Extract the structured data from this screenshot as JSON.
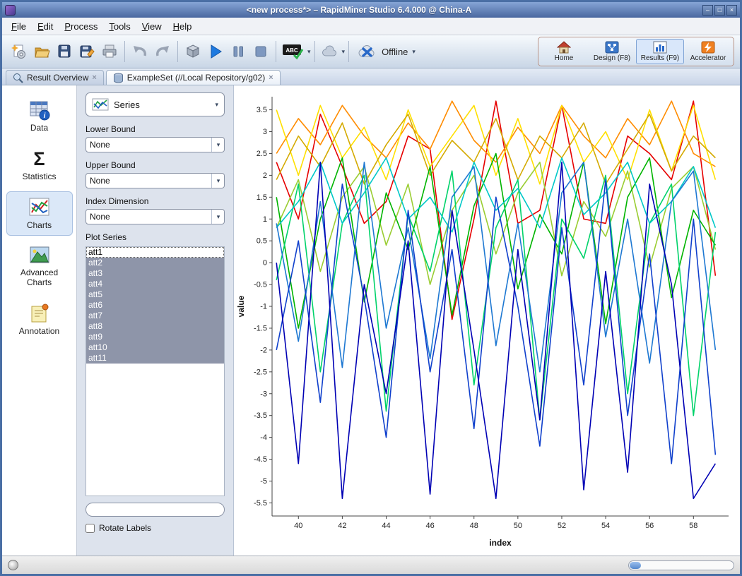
{
  "window": {
    "title": "<new process*> – RapidMiner Studio 6.4.000 @ China-A"
  },
  "icons": {
    "caret": "▾",
    "close": "×",
    "minimize": "–",
    "maximize": "□",
    "info": "i",
    "sigma": "Σ",
    "check": "✓"
  },
  "menu": {
    "items": [
      "File",
      "Edit",
      "Process",
      "Tools",
      "View",
      "Help"
    ]
  },
  "toolbar": {
    "abc_label": "ABC",
    "offline_label": "Offline"
  },
  "perspectives": {
    "items": [
      "Home",
      "Design (F8)",
      "Results (F9)",
      "Accelerator"
    ]
  },
  "tabs": [
    "Result Overview",
    "ExampleSet (//Local Repository/g02)"
  ],
  "sidebar": {
    "items": [
      "Data",
      "Statistics",
      "Charts",
      "Advanced Charts",
      "Annotation"
    ]
  },
  "config": {
    "chart_type": "Series",
    "lower_bound_label": "Lower Bound",
    "lower_bound_value": "None",
    "upper_bound_label": "Upper Bound",
    "upper_bound_value": "None",
    "index_dim_label": "Index Dimension",
    "index_dim_value": "None",
    "plot_series_label": "Plot Series",
    "series_items": [
      "att1",
      "att2",
      "att3",
      "att4",
      "att5",
      "att6",
      "att7",
      "att8",
      "att9",
      "att10",
      "att11"
    ],
    "filter_value": "",
    "rotate_labels_label": "Rotate Labels"
  },
  "chart_data": {
    "type": "line",
    "title": "",
    "xlabel": "index",
    "ylabel": "value",
    "xlim": [
      38.8,
      59.6
    ],
    "ylim": [
      -5.8,
      3.8
    ],
    "x_ticks": [
      40,
      42,
      44,
      46,
      48,
      50,
      52,
      54,
      56,
      58
    ],
    "y_ticks": [
      3.5,
      3,
      2.5,
      2,
      1.5,
      1,
      0.5,
      0,
      -0.5,
      -1,
      -1.5,
      -2,
      -2.5,
      -3,
      -3.5,
      -4,
      -4.5,
      -5,
      -5.5
    ],
    "grid": false,
    "legend": "none",
    "x": [
      39,
      40,
      41,
      42,
      43,
      44,
      45,
      46,
      47,
      48,
      49,
      50,
      51,
      52,
      53,
      54,
      55,
      56,
      57,
      58,
      59
    ],
    "series": [
      {
        "name": "att1",
        "color": "#e60000",
        "values": [
          2.3,
          1.0,
          3.4,
          2.2,
          0.9,
          1.4,
          2.9,
          2.6,
          -1.3,
          1.0,
          3.7,
          0.9,
          1.2,
          3.6,
          1.0,
          0.9,
          2.9,
          2.5,
          1.9,
          3.7,
          -0.3
        ]
      },
      {
        "name": "att2",
        "color": "#ff8c00",
        "values": [
          2.5,
          3.3,
          2.7,
          3.6,
          2.9,
          2.4,
          3.2,
          2.6,
          3.7,
          2.8,
          2.3,
          3.1,
          2.5,
          3.6,
          2.9,
          2.4,
          3.3,
          2.7,
          3.7,
          2.5,
          2.2
        ]
      },
      {
        "name": "att3",
        "color": "#ffe000",
        "values": [
          3.5,
          2.0,
          3.6,
          2.4,
          3.1,
          1.9,
          3.5,
          2.2,
          2.9,
          3.6,
          2.0,
          3.3,
          1.8,
          3.6,
          2.3,
          3.0,
          1.9,
          3.5,
          2.1,
          3.6,
          1.9
        ]
      },
      {
        "name": "att4",
        "color": "#d4aa00",
        "values": [
          1.9,
          2.9,
          2.2,
          3.2,
          1.8,
          2.7,
          3.4,
          2.0,
          2.8,
          2.3,
          3.3,
          1.9,
          2.9,
          2.4,
          3.2,
          1.8,
          2.6,
          3.4,
          2.1,
          2.9,
          2.4
        ]
      },
      {
        "name": "att5",
        "color": "#9acd32",
        "values": [
          0.8,
          1.9,
          -0.2,
          1.5,
          2.2,
          0.4,
          1.8,
          -0.5,
          1.2,
          2.0,
          0.2,
          1.6,
          2.3,
          -0.3,
          1.4,
          0.6,
          2.1,
          -0.1,
          1.7,
          2.2,
          0.3
        ]
      },
      {
        "name": "att6",
        "color": "#00b400",
        "values": [
          1.5,
          -1.5,
          1.0,
          2.4,
          -0.9,
          1.6,
          0.3,
          2.2,
          -1.2,
          1.3,
          2.5,
          -0.6,
          1.1,
          0.2,
          2.3,
          -1.4,
          1.5,
          2.4,
          -0.8,
          1.2,
          0.4
        ]
      },
      {
        "name": "att7",
        "color": "#00d26a",
        "values": [
          -0.4,
          1.8,
          -2.5,
          0.9,
          2.0,
          -3.4,
          1.1,
          -0.2,
          2.1,
          -2.8,
          0.8,
          1.9,
          -3.6,
          1.0,
          0.1,
          2.0,
          -3.0,
          0.9,
          1.8,
          -3.5,
          0.7
        ]
      },
      {
        "name": "att8",
        "color": "#00c8c8",
        "values": [
          0.8,
          1.4,
          2.3,
          0.9,
          1.6,
          2.4,
          1.0,
          1.5,
          0.7,
          2.3,
          1.2,
          1.7,
          0.8,
          2.4,
          1.1,
          1.6,
          2.3,
          0.9,
          1.4,
          2.2,
          0.8
        ]
      },
      {
        "name": "att9",
        "color": "#1e78d2",
        "values": [
          0.9,
          -1.8,
          1.4,
          -2.4,
          2.3,
          -1.5,
          0.8,
          -2.2,
          1.5,
          2.2,
          -1.9,
          0.9,
          -2.5,
          1.6,
          2.3,
          -1.7,
          1.0,
          -2.3,
          1.4,
          2.1,
          -2.0
        ]
      },
      {
        "name": "att10",
        "color": "#1040cc",
        "values": [
          -2.0,
          0.5,
          -3.2,
          1.8,
          -0.8,
          -4.0,
          1.2,
          -2.5,
          0.3,
          -3.8,
          1.5,
          -1.0,
          -4.2,
          0.8,
          -2.8,
          1.9,
          -3.5,
          0.2,
          -4.6,
          1.0,
          -4.4
        ]
      },
      {
        "name": "att11",
        "color": "#0000b4",
        "values": [
          0.0,
          -4.6,
          2.3,
          -5.4,
          -0.5,
          -3.0,
          0.5,
          -5.3,
          1.2,
          -2.0,
          -5.4,
          0.3,
          -3.6,
          2.3,
          -5.2,
          -0.2,
          -4.8,
          1.8,
          -0.5,
          -5.4,
          -4.6
        ]
      }
    ]
  }
}
